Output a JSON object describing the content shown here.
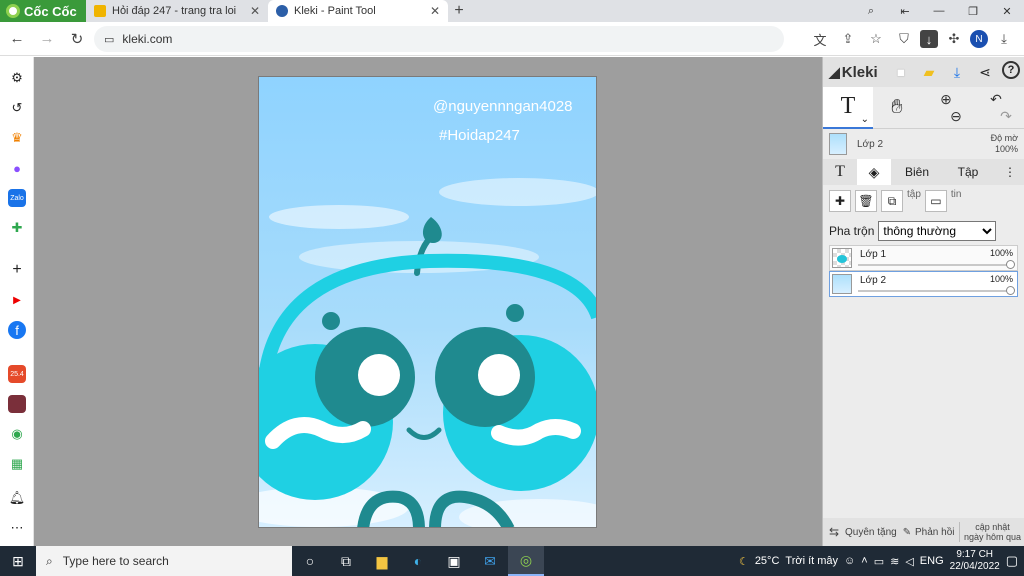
{
  "browser": {
    "brand": "Cốc Cốc",
    "tabs": [
      {
        "title": "Hỏi đáp 247 - trang tra loi",
        "close": "✕"
      },
      {
        "title": "Kleki - Paint Tool",
        "close": "✕"
      }
    ],
    "new_tab": "+",
    "url": "kleki.com",
    "profile_initial": "N"
  },
  "canvas": {
    "watermark_line1": "@nguyennngan4028",
    "watermark_line2": "#Hoidap247",
    "colors": {
      "sky": "#9fdcff",
      "cyan": "#1fd0e3",
      "teal": "#1f8a8f",
      "white": "#ffffff"
    }
  },
  "kleki": {
    "brand": "Kleki",
    "layer_preview": {
      "name": "Lớp 2",
      "opacity_label": "Độ mờ",
      "opacity_value": "100%"
    },
    "subtabs": {
      "edit": "Biên",
      "file": "Tập"
    },
    "layer_action_labels": {
      "copy": "tập",
      "info": "tin"
    },
    "blend_label": "Pha trộn",
    "blend_value": "thông thường",
    "layers": [
      {
        "name": "Lớp 1",
        "opacity": "100%"
      },
      {
        "name": "Lớp 2",
        "opacity": "100%"
      }
    ],
    "footer": {
      "donate": "Quyên tặng",
      "feedback": "Phản hồi",
      "updated_line1": "cập nhật",
      "updated_line2": "ngày hôm qua"
    }
  },
  "taskbar": {
    "search_placeholder": "Type here to search",
    "weather": "25°C",
    "weather_desc": "Trời ít mây",
    "lang": "ENG",
    "time": "9:17 CH",
    "date": "22/04/2022"
  }
}
